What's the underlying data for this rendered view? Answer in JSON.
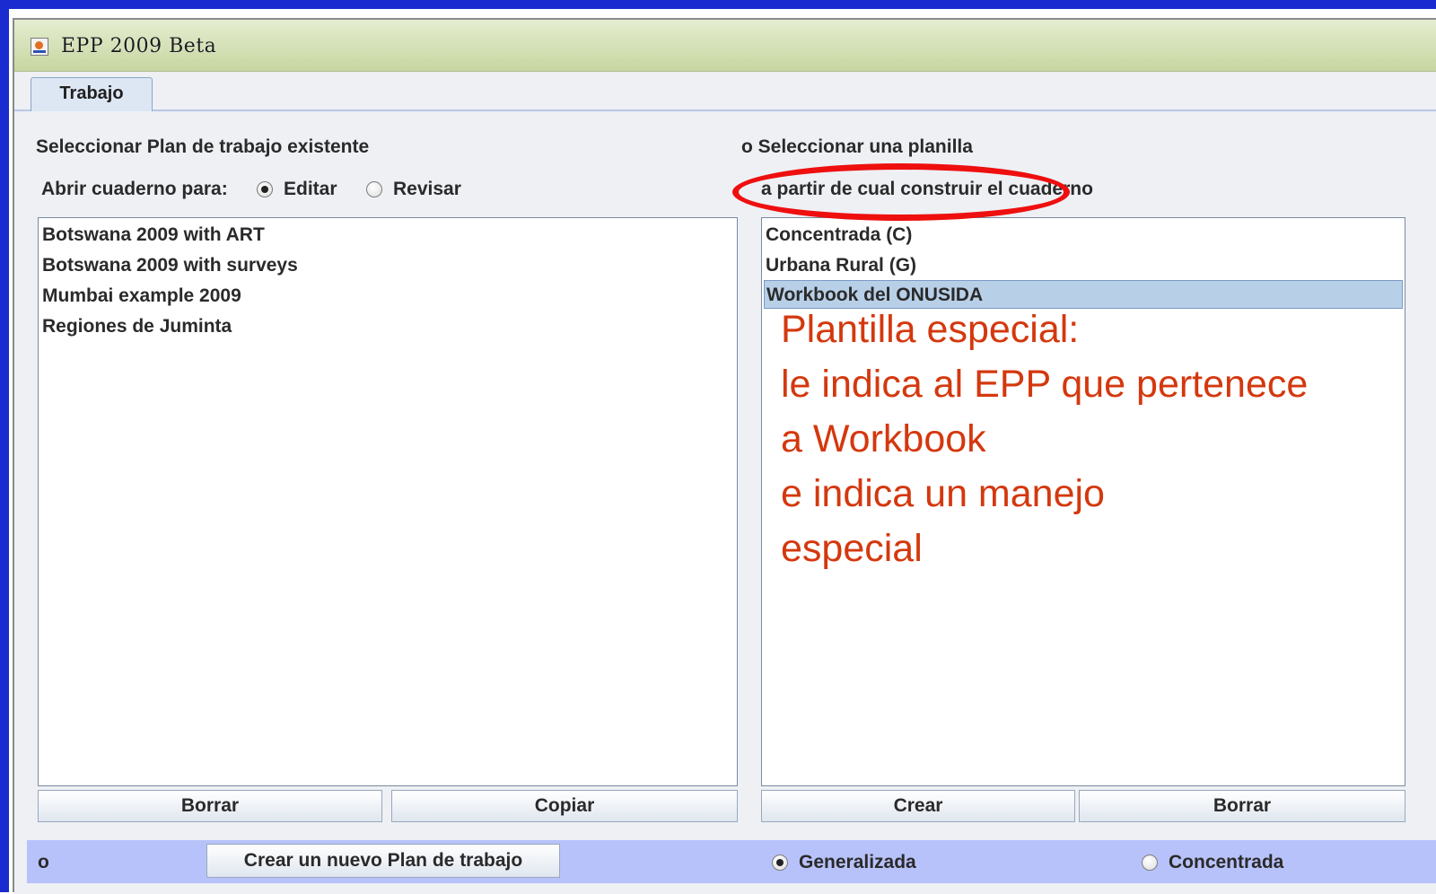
{
  "window": {
    "title": "EPP 2009 Beta"
  },
  "tabs": [
    {
      "label": "Trabajo"
    }
  ],
  "left": {
    "heading": "Seleccionar Plan de trabajo existente",
    "open_label": "Abrir cuaderno para:",
    "radio_edit": "Editar",
    "radio_review": "Revisar",
    "selected_mode": "Editar",
    "items": [
      "Botswana 2009 with ART",
      "Botswana 2009 with surveys",
      "Mumbai example 2009",
      "Regiones de Juminta"
    ],
    "delete_button": "Borrar",
    "copy_button": "Copiar"
  },
  "right": {
    "heading": "o Seleccionar una planilla",
    "subheading": "a partir de cual construir el cuaderno",
    "items": [
      "Concentrada (C)",
      "Urbana Rural (G)",
      "Workbook del ONUSIDA"
    ],
    "selected_item": "Workbook del ONUSIDA",
    "create_button": "Crear",
    "delete_button": "Borrar"
  },
  "bottom": {
    "or_label": "o",
    "new_plan_button": "Crear un nuevo Plan de trabajo",
    "radio_generalized": "Generalizada",
    "radio_concentrated": "Concentrada",
    "selected_epidemic": "Generalizada"
  },
  "annotation": {
    "lines": [
      "Plantilla especial:",
      "le indica al EPP que pertenece",
      "a Workbook",
      "e indica un manejo",
      "especial"
    ],
    "color": "#d4380e",
    "highlight_color": "#ee0f0f"
  }
}
